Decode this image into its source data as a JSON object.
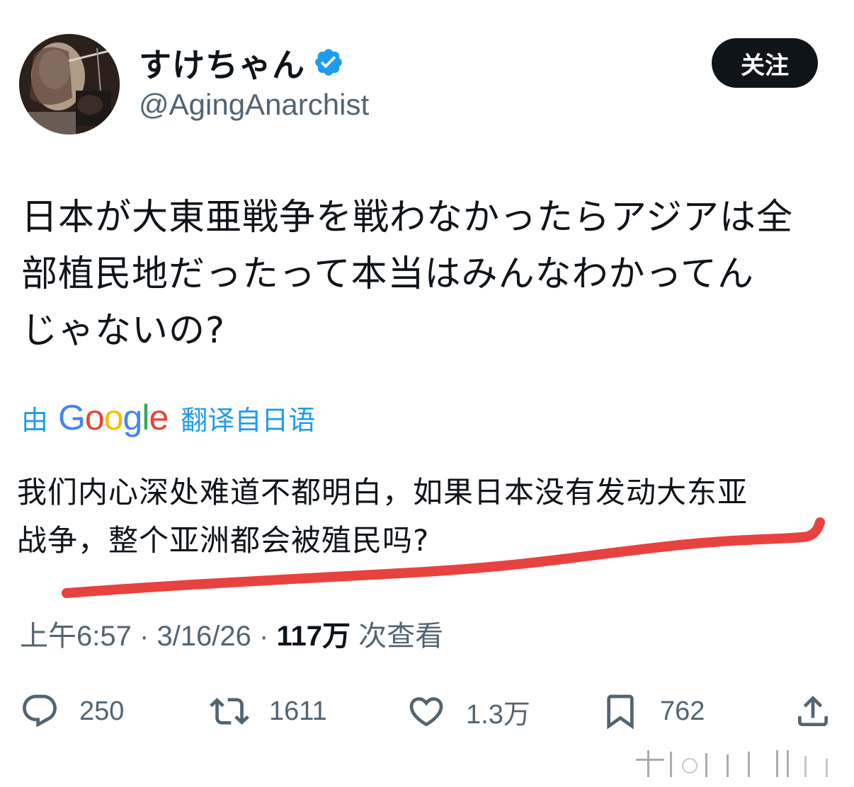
{
  "author": {
    "display_name": "すけちゃん",
    "handle": "@AgingAnarchist",
    "verified": true
  },
  "follow_button": {
    "label": "关注"
  },
  "tweet": {
    "text_lines": [
      "日本が大東亜戦争を戦わなかったらアジアは全",
      "部植民地だったって本当はみんなわかってん",
      "じゃないの?"
    ]
  },
  "translation": {
    "prefix": "由",
    "provider": "Google",
    "suffix": "翻译自日语",
    "text_lines": [
      "我们内心深处难道不都明白，如果日本没有发动大东亚",
      "战争，整个亚洲都会被殖民吗?"
    ]
  },
  "meta": {
    "time": "上午6:57",
    "separator": "·",
    "date": "3/16/26",
    "views_count": "117万",
    "views_label": "次查看"
  },
  "actions": {
    "reply_count": "250",
    "repost_count": "1611",
    "like_count": "1.3万",
    "bookmark_count": "762"
  },
  "icons": {
    "verified": "verified-badge-icon",
    "reply": "comment-icon",
    "repost": "repost-icon",
    "like": "heart-icon",
    "bookmark": "bookmark-icon",
    "share": "share-icon"
  },
  "colors": {
    "accent": "#1d9bf0",
    "text": "#0f1419",
    "secondary": "#536471",
    "annotation": "#e8423f"
  }
}
